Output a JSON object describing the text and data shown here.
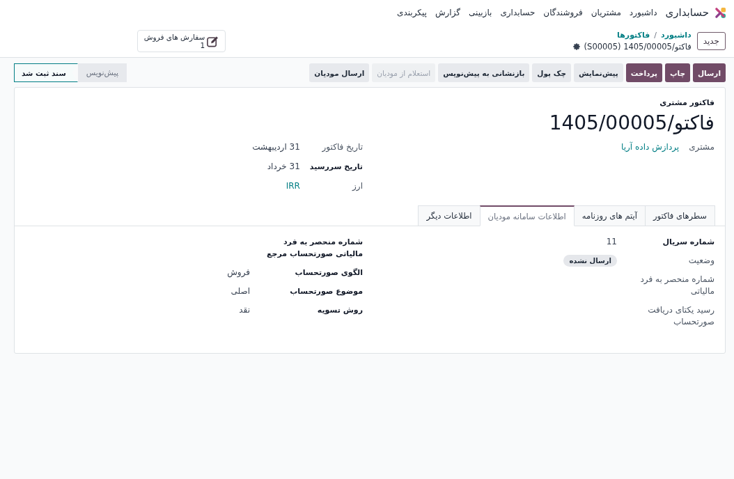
{
  "navbar": {
    "app_name": "حسابداری",
    "menu": [
      "داشبورد",
      "مشتریان",
      "فروشندگان",
      "حسابداری",
      "بازبینی",
      "گزارش",
      "پیکربندی"
    ]
  },
  "control_panel": {
    "new_button": "جدید",
    "breadcrumb": {
      "links": [
        "داشبورد",
        "فاکتورها"
      ],
      "separator": "/",
      "current": "فاکتو/1405/00005 (S00005)"
    },
    "smart_button": {
      "label": "سفارش های فروش",
      "count": "1"
    }
  },
  "action_buttons": [
    {
      "label": "ارسال",
      "kind": "primary",
      "disabled": false
    },
    {
      "label": "چاپ",
      "kind": "primary",
      "disabled": false
    },
    {
      "label": "پرداخت",
      "kind": "primary",
      "disabled": false
    },
    {
      "label": "پیش‌نمایش",
      "kind": "secondary",
      "disabled": false
    },
    {
      "label": "چک پول",
      "kind": "secondary",
      "disabled": false
    },
    {
      "label": "بازنشانی به پیش‌نویس",
      "kind": "secondary",
      "disabled": false
    },
    {
      "label": "استعلام از مودیان",
      "kind": "secondary",
      "disabled": true
    },
    {
      "label": "ارسال مودیان",
      "kind": "secondary",
      "disabled": false
    }
  ],
  "statusbar": [
    {
      "label": "پیش‌نویس",
      "selected": false
    },
    {
      "label": "سند ثبت شد",
      "selected": true
    }
  ],
  "sheet": {
    "subtitle": "فاکتور مشتری",
    "title": "فاکتو/1405/00005",
    "field_groups": [
      {
        "fields": [
          {
            "label": "مشتری",
            "bold": false,
            "kind": "link",
            "value": "پردازش داده آریا"
          }
        ]
      },
      {
        "fields": [
          {
            "label": "تاریخ فاکتور",
            "bold": false,
            "kind": "text",
            "value": "31 اردیبهشت"
          },
          {
            "label": "تاریخ سررسید",
            "bold": true,
            "kind": "text",
            "value": "31 خرداد"
          },
          {
            "label": "ارز",
            "bold": false,
            "kind": "link",
            "value": "IRR"
          }
        ]
      }
    ],
    "tabs": [
      {
        "label": "سطرهای فاکتور",
        "selected": false
      },
      {
        "label": "آیتم های روزنامه",
        "selected": false
      },
      {
        "label": "اطلاعات سامانه مودیان",
        "selected": true
      },
      {
        "label": "اطلاعات دیگر",
        "selected": false
      }
    ],
    "tab_groups": [
      {
        "fields": [
          {
            "label": "شماره سریال",
            "bold": true,
            "kind": "text",
            "value": "11"
          },
          {
            "label": "وضعیت",
            "bold": false,
            "kind": "badge",
            "value": "ارسال نشده"
          },
          {
            "label": "شماره منحصر به فرد مالیاتی",
            "bold": false,
            "kind": "text"
          },
          {
            "label": "رسید یکتای دریافت صورتحساب",
            "bold": false,
            "kind": "text"
          }
        ]
      },
      {
        "fields": [
          {
            "label": "شماره منحصر به فرد مالیاتی صورتحساب مرجع",
            "bold": true,
            "kind": "text"
          },
          {
            "label": "الگوی صورتحساب",
            "bold": true,
            "kind": "text",
            "value": "فروش"
          },
          {
            "label": "موضوع صورتحساب",
            "bold": true,
            "kind": "text",
            "value": "اصلی"
          },
          {
            "label": "روش تسویه",
            "bold": true,
            "kind": "text",
            "value": "نقد"
          }
        ]
      }
    ]
  }
}
